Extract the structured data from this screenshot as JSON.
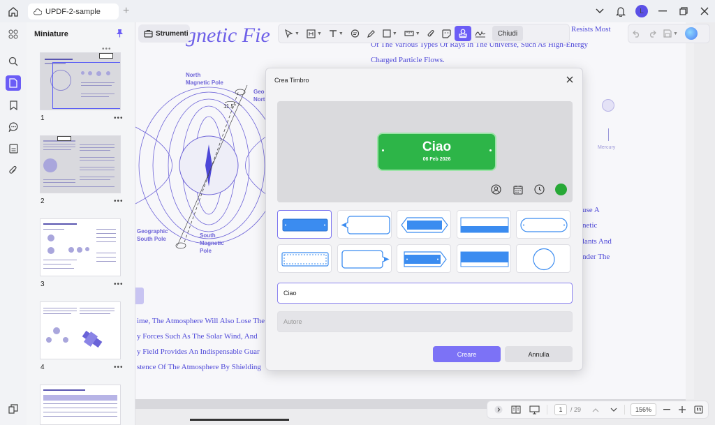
{
  "window": {
    "tab_title": "UPDF-2-sample",
    "avatar_letter": "L"
  },
  "sidebar": {
    "panel_title": "Miniature",
    "pages": [
      {
        "num": "1"
      },
      {
        "num": "2"
      },
      {
        "num": "3"
      },
      {
        "num": "4"
      }
    ]
  },
  "toolbar": {
    "strumenti_label": "Strumenti",
    "close_label": "Chiudi"
  },
  "document": {
    "title_fragment": "gnetic Fie",
    "right_lines": [
      "Resists Most",
      "Of The Various Types Of Rays In The Universe, Such As High-Energy",
      "Charged Particle Flows."
    ],
    "diagram_labels": {
      "north_magnetic": "North\nMagnetic Pole",
      "geo_north": "Geo\nNort",
      "angle": "11.5°",
      "geo_south": "Geographic\nSouth Pole",
      "south_magnetic": "South\nMagnetic\nPole",
      "mercury": "Mercury"
    },
    "right_fragments": [
      "use A",
      "netic",
      "lants And",
      "nder The"
    ],
    "left_lines": [
      "ime, The Atmosphere Will Also Lose The",
      "y Forces Such As The Solar Wind, And",
      "y Field Provides An Indispensable Guar",
      "stence Of The Atmosphere By Shielding"
    ]
  },
  "dialog": {
    "title": "Crea Timbro",
    "stamp_text": "Ciao",
    "stamp_date": "06 Feb 2026",
    "stamp_color": "#2db548",
    "text_value": "Ciao",
    "author_placeholder": "Autore",
    "create_label": "Creare",
    "cancel_label": "Annulla"
  },
  "statusbar": {
    "current_page": "1",
    "total_pages": "/ 29",
    "zoom": "156%"
  },
  "colors": {
    "accent": "#6b5cf6",
    "doc_text": "#4d47d8"
  }
}
